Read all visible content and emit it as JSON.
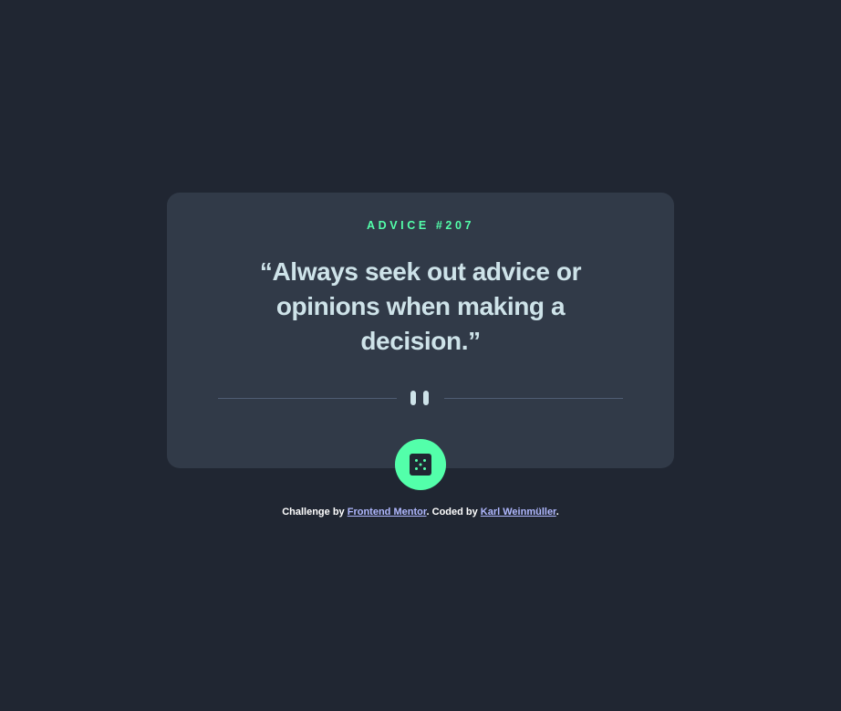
{
  "card": {
    "advice_label": "ADVICE #207",
    "quote": "“Always seek out advice or opinions when making a decision.”"
  },
  "icons": {
    "divider": "pause-icon",
    "button": "dice-icon"
  },
  "footer": {
    "challenge_prefix": "Challenge by ",
    "challenge_link": "Frontend Mentor",
    "coded_prefix": ". Coded by ",
    "coded_link": "Karl Weinmüller",
    "suffix": "."
  },
  "colors": {
    "background": "#202632",
    "card": "#313a48",
    "accent": "#53ffaa",
    "text": "#cee3e9",
    "link": "#b0b8ff",
    "divider": "#4f5d74"
  }
}
